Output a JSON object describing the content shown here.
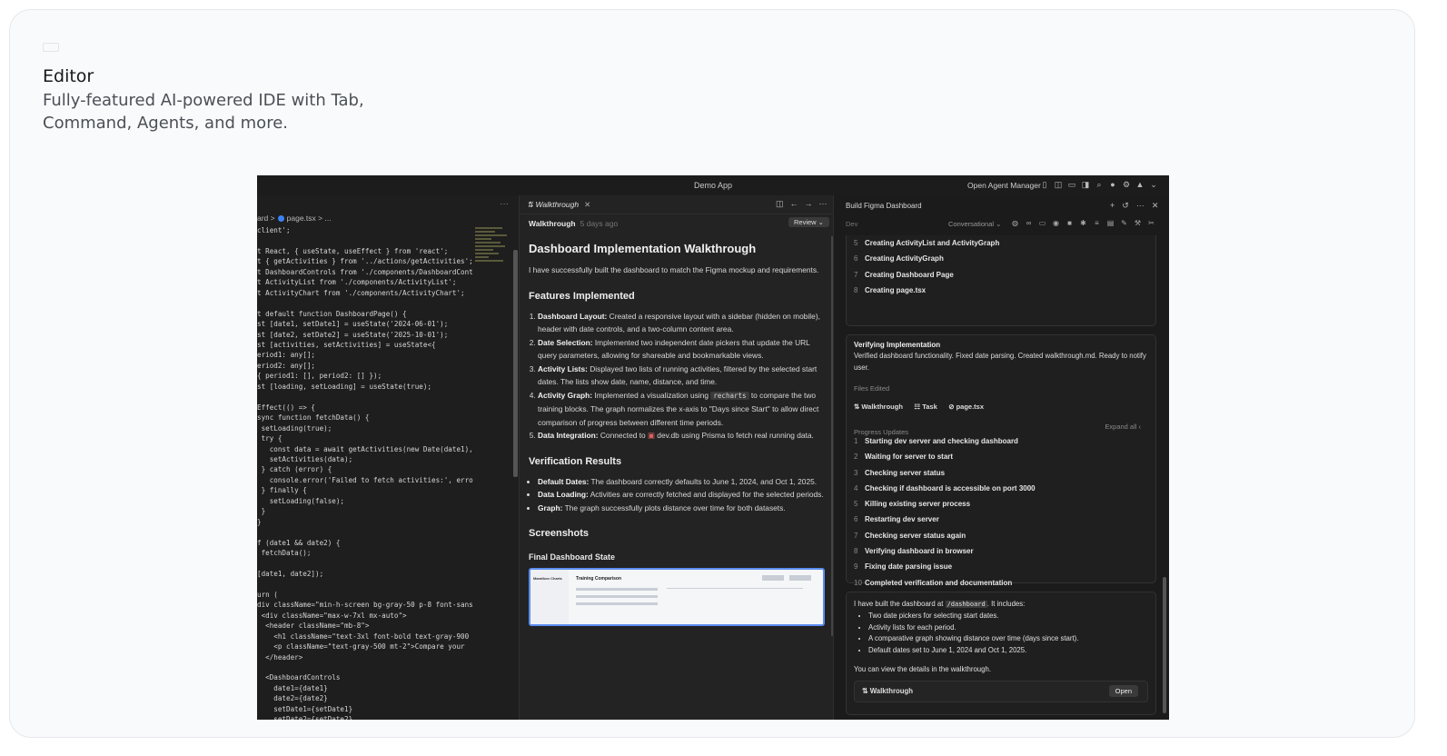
{
  "card": {
    "title": "Editor",
    "description": "Fully-featured AI-powered IDE with Tab, Command, Agents, and more."
  },
  "window": {
    "title": "Demo App",
    "open_agent_manager": "Open Agent Manager"
  },
  "code_pane": {
    "more": "···",
    "breadcrumb_prefix": "ard",
    "breadcrumb_sep": ">",
    "breadcrumb_file": "page.tsx",
    "breadcrumb_tail": "> ...",
    "lines": [
      "client';",
      "",
      "t React, { useState, useEffect } from 'react';",
      "t { getActivities } from '../actions/getActivities';",
      "t DashboardControls from './components/DashboardCont",
      "t ActivityList from './components/ActivityList';",
      "t ActivityChart from './components/ActivityChart';",
      "",
      "t default function DashboardPage() {",
      "st [date1, setDate1] = useState('2024-06-01');",
      "st [date2, setDate2] = useState('2025-10-01');",
      "st [activities, setActivities] = useState<{",
      "eriod1: any[];",
      "eriod2: any[];",
      "{ period1: [], period2: [] });",
      "st [loading, setLoading] = useState(true);",
      "",
      "Effect(() => {",
      "sync function fetchData() {",
      " setLoading(true);",
      " try {",
      "   const data = await getActivities(new Date(date1),",
      "   setActivities(data);",
      " } catch (error) {",
      "   console.error('Failed to fetch activities:', erro",
      " } finally {",
      "   setLoading(false);",
      " }",
      "}",
      "",
      "f (date1 && date2) {",
      " fetchData();",
      "",
      "[date1, date2]);",
      "",
      "urn (",
      "div className=\"min-h-screen bg-gray-50 p-8 font-sans",
      " <div className=\"max-w-7xl mx-auto\">",
      "  <header className=\"mb-8\">",
      "    <h1 className=\"text-3xl font-bold text-gray-900",
      "    <p className=\"text-gray-500 mt-2\">Compare your",
      "  </header>",
      "",
      "  <DashboardControls",
      "    date1={date1}",
      "    date2={date2}",
      "    setDate1={setDate1}",
      "    setDate2={setDate2}"
    ]
  },
  "walkthrough": {
    "tab_label": "Walkthrough",
    "tab_close": "✕",
    "header": "Walkthrough",
    "when": "5 days ago",
    "review": "Review ⌄",
    "title": "Dashboard Implementation Walkthrough",
    "intro": "I have successfully built the dashboard to match the Figma mockup and requirements.",
    "features_heading": "Features Implemented",
    "features": [
      {
        "label": "Dashboard Layout:",
        "text": " Created a responsive layout with a sidebar (hidden on mobile), header with date controls, and a two-column content area."
      },
      {
        "label": "Date Selection:",
        "text": " Implemented two independent date pickers that update the URL query parameters, allowing for shareable and bookmarkable views."
      },
      {
        "label": "Activity Lists:",
        "text": " Displayed two lists of running activities, filtered by the selected start dates. The lists show date, name, distance, and time."
      },
      {
        "label": "Activity Graph:",
        "text_before": " Implemented a visualization using ",
        "code": "recharts",
        "text_after": " to compare the two training blocks. The graph normalizes the x-axis to \"Days since Start\" to allow direct comparison of progress between different time periods."
      },
      {
        "label": "Data Integration:",
        "text_before": " Connected to ",
        "db": "dev.db",
        "text_after": " using Prisma to fetch real running data."
      }
    ],
    "verification_heading": "Verification Results",
    "verification": [
      {
        "label": "Default Dates:",
        "text": " The dashboard correctly defaults to June 1, 2024, and Oct 1, 2025."
      },
      {
        "label": "Data Loading:",
        "text": " Activities are correctly fetched and displayed for the selected periods."
      },
      {
        "label": "Graph:",
        "text": " The graph successfully plots distance over time for both datasets."
      }
    ],
    "screenshots_heading": "Screenshots",
    "final_state": "Final Dashboard State",
    "preview": {
      "sidebar_title": "Marathon Charts",
      "title": "Training Comparison"
    }
  },
  "agent": {
    "title": "Build Figma Dashboard",
    "branch": "Dev",
    "mode": "Conversational ⌄",
    "top_steps": [
      {
        "n": "5",
        "label": "Creating ActivityList and ActivityGraph"
      },
      {
        "n": "6",
        "label": "Creating ActivityGraph"
      },
      {
        "n": "7",
        "label": "Creating Dashboard Page"
      },
      {
        "n": "8",
        "label": "Creating page.tsx"
      }
    ],
    "verify_heading": "Verifying Implementation",
    "verify_text": "Verified dashboard functionality. Fixed date parsing. Created walkthrough.md. Ready to notify user.",
    "files_edited_label": "Files Edited",
    "files": [
      "Walkthrough",
      "Task",
      "page.tsx"
    ],
    "progress_label": "Progress Updates",
    "expand_all": "Expand all ‹",
    "progress": [
      {
        "n": "1",
        "label": "Starting dev server and checking dashboard"
      },
      {
        "n": "2",
        "label": "Waiting for server to start"
      },
      {
        "n": "3",
        "label": "Checking server status"
      },
      {
        "n": "4",
        "label": "Checking if dashboard is accessible on port 3000"
      },
      {
        "n": "5",
        "label": "Killing existing server process"
      },
      {
        "n": "6",
        "label": "Restarting dev server"
      },
      {
        "n": "7",
        "label": "Checking server status again"
      },
      {
        "n": "8",
        "label": "Verifying dashboard in browser"
      },
      {
        "n": "9",
        "label": "Fixing date parsing issue"
      },
      {
        "n": "10",
        "label": "Completed verification and documentation"
      }
    ],
    "summary_before": "I have built the dashboard at ",
    "summary_code": "/dashboard",
    "summary_after": ". It includes:",
    "summary_items": [
      "Two date pickers for selecting start dates.",
      "Activity lists for each period.",
      "A comparative graph showing distance over time (days since start).",
      "Default dates set to June 1, 2024 and Oct 1, 2025."
    ],
    "summary_footer": "You can view the details in the walkthrough.",
    "artifact_label": "Walkthrough",
    "open_button": "Open"
  }
}
